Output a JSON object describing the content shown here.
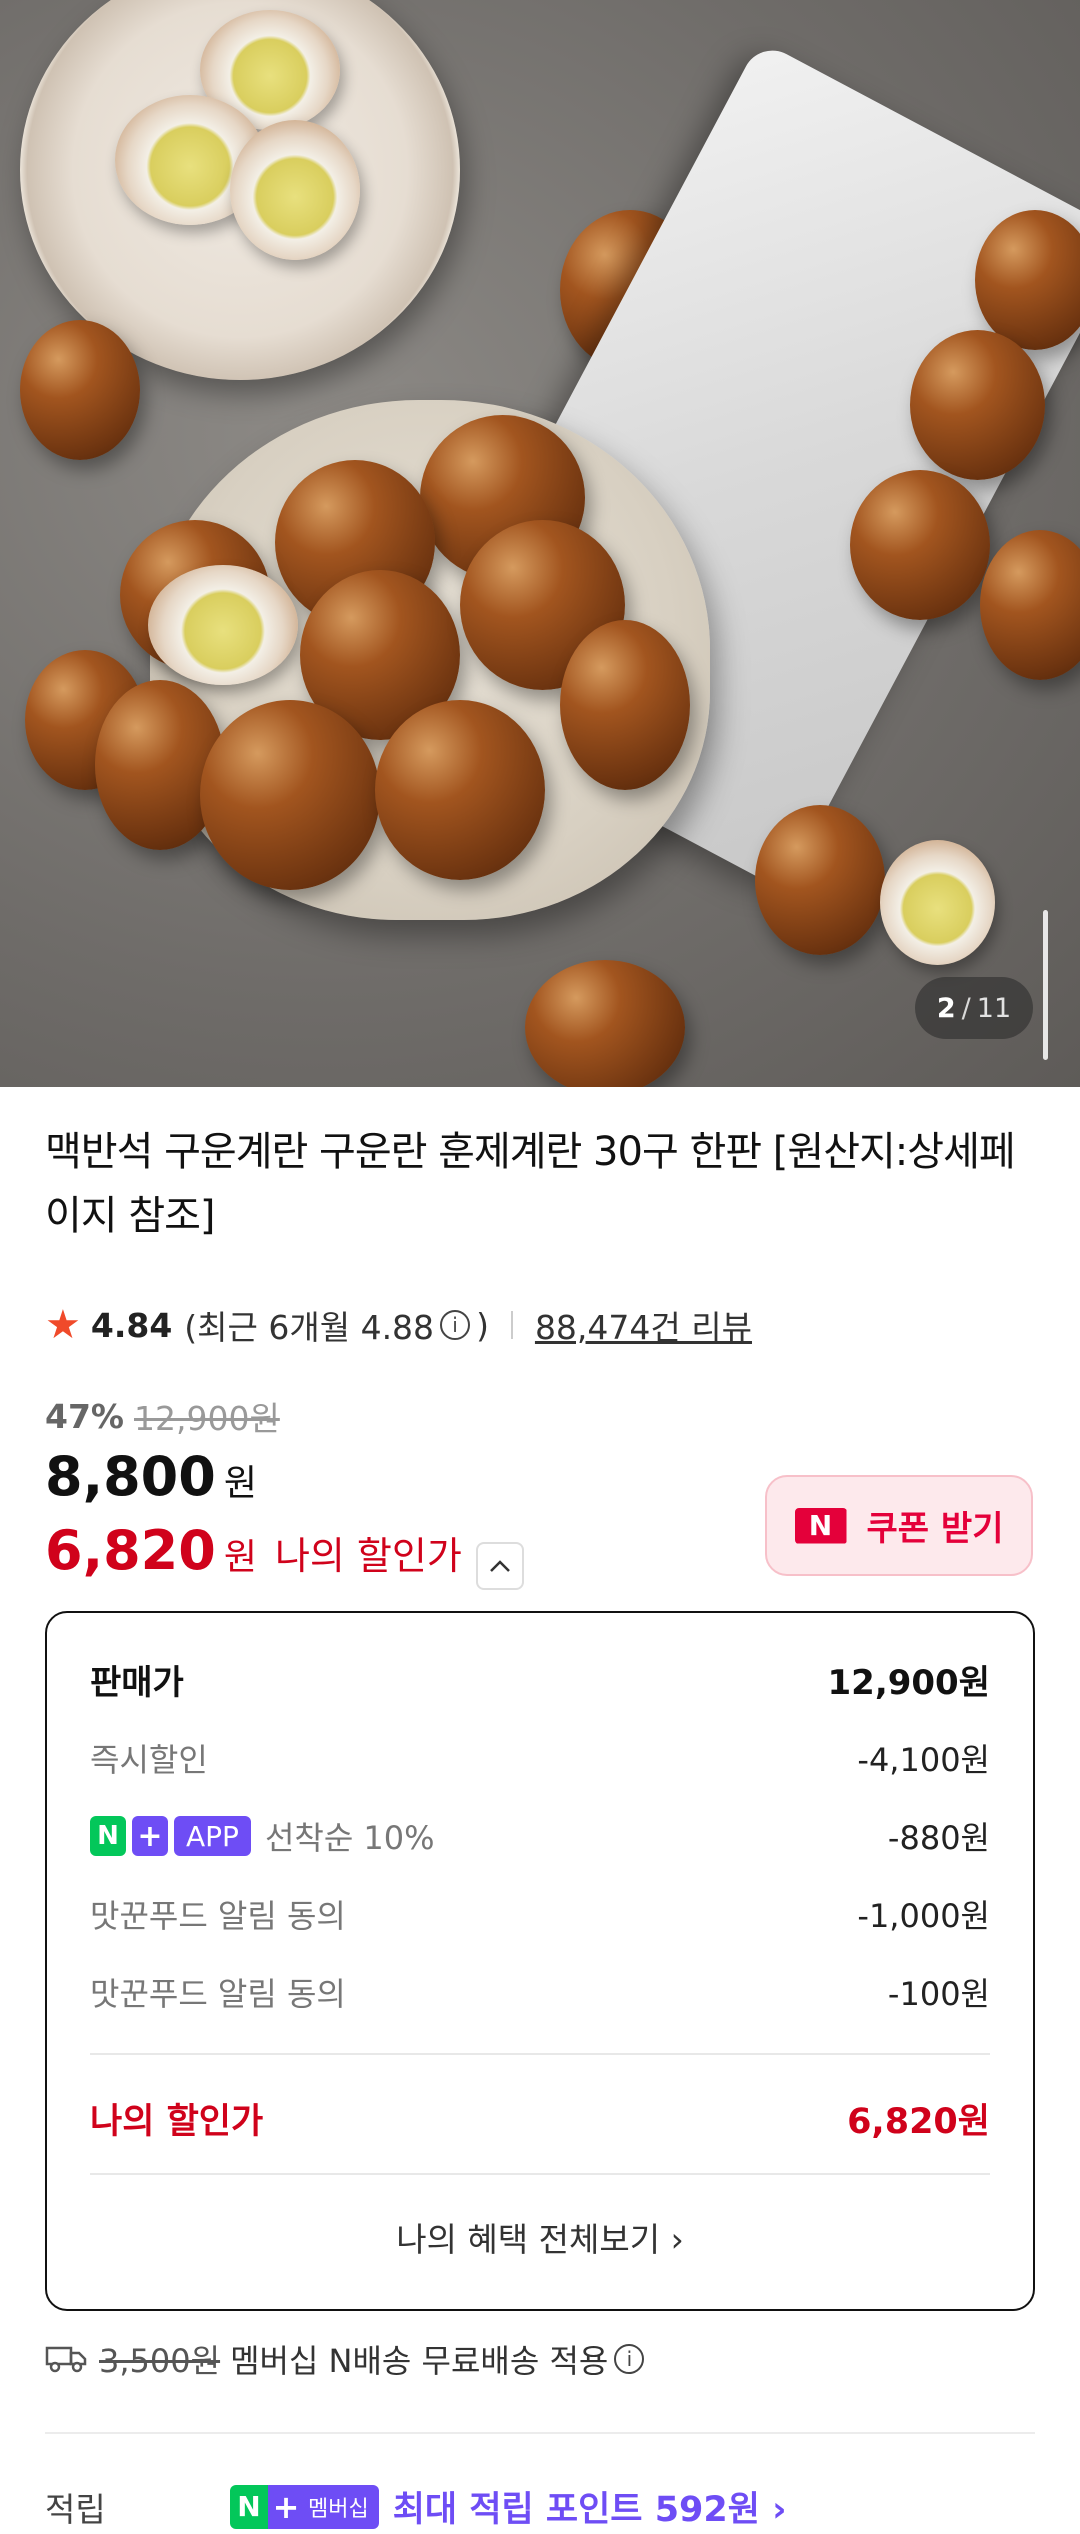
{
  "gallery": {
    "current": "2",
    "separator": "/",
    "total": "11"
  },
  "product": {
    "title": "맥반석 구운계란 구운란 훈제계란 30구 한판 [원산지:상세페이지 참조]",
    "rating": "4.84",
    "recent_rating": "(최근 6개월 4.88",
    "recent_rating_close": ")",
    "review_count": "88,474건 리뷰",
    "discount_percent": "47%",
    "original_price": "12,900원",
    "price": "8,800",
    "price_unit": "원",
    "my_price": "6,820",
    "my_price_unit": "원",
    "my_price_label": "나의 할인가"
  },
  "coupon": {
    "label": "쿠폰 받기",
    "icon": "N"
  },
  "breakdown": {
    "sale_price_label": "판매가",
    "sale_price": "12,900원",
    "rows": [
      {
        "label": "즉시할인",
        "value": "-4,100원"
      },
      {
        "label": "선착순 10%",
        "value": "-880원",
        "badges": [
          "N",
          "+",
          "APP"
        ]
      },
      {
        "label": "맛꾼푸드 알림 동의",
        "value": "-1,000원"
      },
      {
        "label": "맛꾼푸드 알림 동의",
        "value": "-100원"
      }
    ],
    "total_label": "나의 할인가",
    "total_value": "6,820원",
    "all_benefits": "나의 혜택 전체보기 ›"
  },
  "shipping": {
    "original_fee": "3,500원",
    "text": "멤버십 N배송 무료배송 적용"
  },
  "points": {
    "label": "적립",
    "badge_n": "N",
    "badge_plus": "+",
    "badge_text": "멤버십",
    "text": "최대 적립 포인트 592원 ›"
  },
  "colors": {
    "accent_red": "#d0021b",
    "coupon_red": "#e4003a",
    "naver_green": "#03c75a",
    "member_purple": "#6e4df5"
  }
}
